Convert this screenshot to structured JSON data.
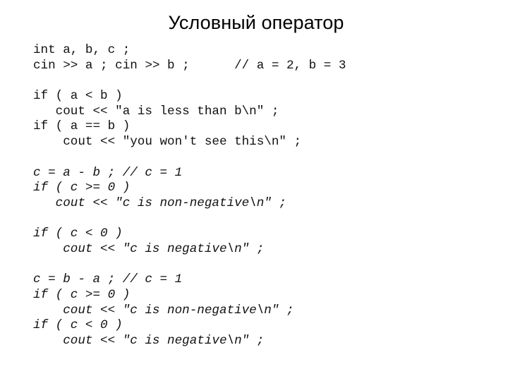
{
  "slide": {
    "title": "Условный оператор"
  },
  "code": {
    "lines": [
      {
        "text": "int a, b, c ;",
        "italic": false
      },
      {
        "text": "cin >> a ; cin >> b ;      // a = 2, b = 3",
        "italic": false
      },
      {
        "text": "",
        "italic": false
      },
      {
        "text": "if ( a < b )",
        "italic": false
      },
      {
        "text": "   cout << \"a is less than b\\n\" ;",
        "italic": false
      },
      {
        "text": "if ( a == b )",
        "italic": false
      },
      {
        "text": "    cout << \"you won't see this\\n\" ;",
        "italic": false
      },
      {
        "text": "",
        "italic": false
      },
      {
        "text": "c = a - b ; // c = 1",
        "italic": true
      },
      {
        "text": "if ( c >= 0 )",
        "italic": true
      },
      {
        "text": "   cout << \"c is non-negative\\n\" ;",
        "italic": true
      },
      {
        "text": "",
        "italic": true
      },
      {
        "text": "if ( c < 0 )",
        "italic": true
      },
      {
        "text": "    cout << \"c is negative\\n\" ;",
        "italic": true
      },
      {
        "text": "",
        "italic": true
      },
      {
        "text": "c = b - a ; // c = 1",
        "italic": true
      },
      {
        "text": "if ( c >= 0 )",
        "italic": true
      },
      {
        "text": "    cout << \"c is non-negative\\n\" ;",
        "italic": true
      },
      {
        "text": "if ( c < 0 )",
        "italic": true
      },
      {
        "text": "    cout << \"c is negative\\n\" ;",
        "italic": true
      }
    ]
  }
}
